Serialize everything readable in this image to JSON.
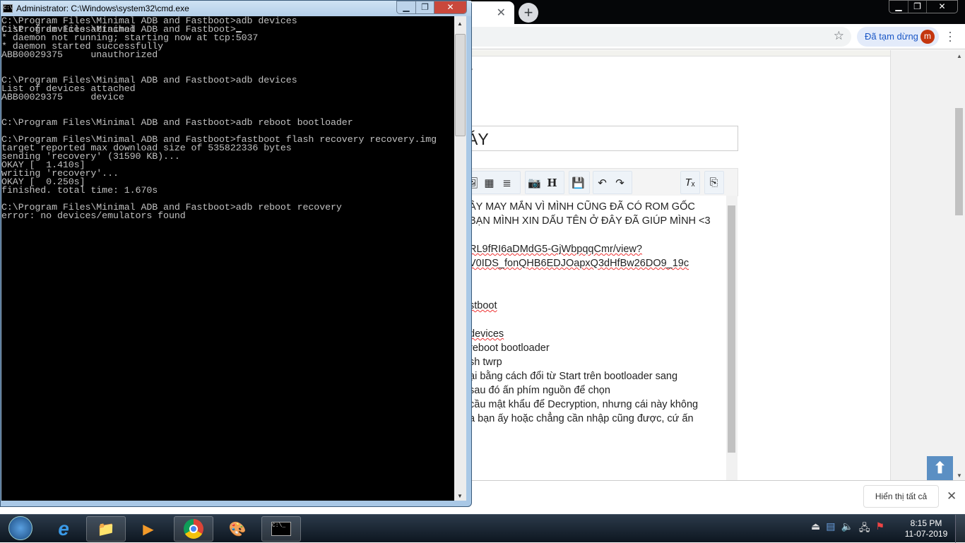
{
  "chrome": {
    "paused_label": "Đã tạm dừng",
    "avatar_letter": "m",
    "title_fragment": "ÁY",
    "title_prefix": "Y",
    "editor_lines": [
      {
        "text": "ÂY MAY MẮN VÌ MÌNH CŨNG ĐÃ CÓ ROM GỐC",
        "spell": false
      },
      {
        "text": "BẠN MÌNH XIN DẤU TÊN Ở ĐÂY ĐÃ GIÚP MÌNH <3",
        "spell": false
      },
      {
        "text": "",
        "spell": false
      },
      {
        "text": "RL9fRI6aDMdG5-GjWbpqqCmr/view?",
        "spell": true
      },
      {
        "text": "V0IDS_fonQHB6EDJOapxQ3dHfBw26DO9_19c",
        "spell": true
      },
      {
        "text": "",
        "spell": false
      },
      {
        "text": "",
        "spell": false
      },
      {
        "text": "stboot",
        "spell": true
      },
      {
        "text": "",
        "spell": false
      },
      {
        "text": "devices",
        "spell": true
      },
      {
        "text": "reboot bootloader",
        "spell": false
      },
      {
        "text": "sh twrp",
        "spell": false
      },
      {
        "text": "ại bằng cách đổi từ Start trên bootloader sang",
        "spell": false
      },
      {
        "text": " sau đó ấn phím nguồn để chọn",
        "spell": false
      },
      {
        "text": " cầu mật khẩu để Decryption, nhưng cái này không",
        "spell": false
      },
      {
        "text": "a bạn ấy hoặc chẳng cần nhập cũng được, cứ ấn",
        "spell": false
      }
    ],
    "show_all_label": "Hiển thị tất cả"
  },
  "cmd": {
    "title": "Administrator: C:\\Windows\\system32\\cmd.exe",
    "lines": [
      "C:\\Program Files\\Minimal ADB and Fastboot>adb devices",
      "List of devices attached",
      "* daemon not running; starting now at tcp:5037",
      "* daemon started successfully",
      "ABB00029375     unauthorized",
      "",
      "",
      "C:\\Program Files\\Minimal ADB and Fastboot>adb devices",
      "List of devices attached",
      "ABB00029375     device",
      "",
      "",
      "C:\\Program Files\\Minimal ADB and Fastboot>adb reboot bootloader",
      "",
      "C:\\Program Files\\Minimal ADB and Fastboot>fastboot flash recovery recovery.img",
      "target reported max download size of 535822336 bytes",
      "sending 'recovery' (31590 KB)...",
      "OKAY [  1.410s]",
      "writing 'recovery'...",
      "OKAY [  0.250s]",
      "finished. total time: 1.670s",
      "",
      "C:\\Program Files\\Minimal ADB and Fastboot>adb reboot recovery",
      "error: no devices/emulators found",
      ""
    ],
    "prompt": "C:\\Program Files\\Minimal ADB and Fastboot>"
  },
  "taskbar": {
    "time": "8:15 PM",
    "date": "11-07-2019"
  }
}
